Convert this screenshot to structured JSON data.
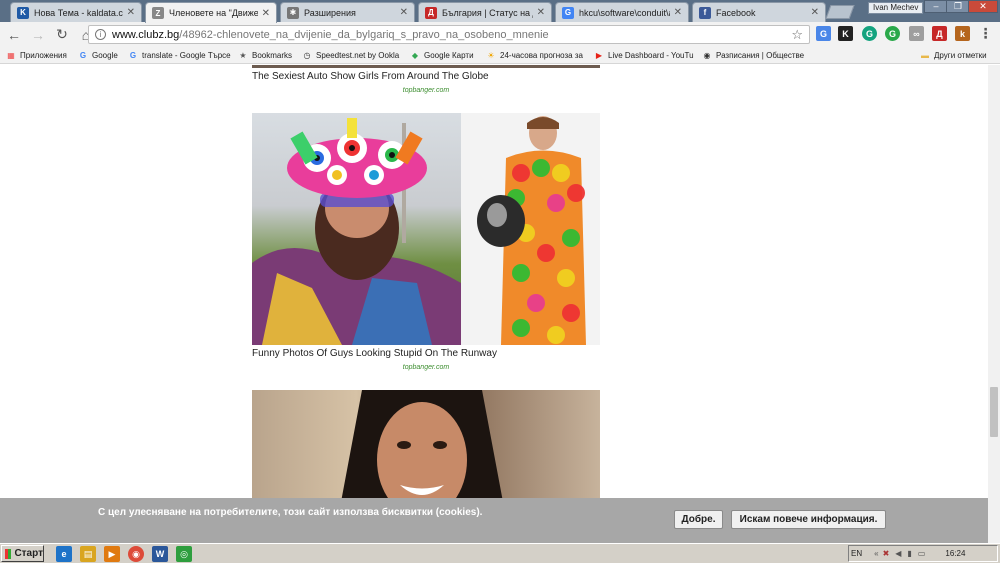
{
  "tabs": [
    {
      "title": "Нова Тема - kaldata.com",
      "favicon": "kaldata-icon",
      "fav_letter": "K",
      "fav_color": "#1f5aa6"
    },
    {
      "title": "Членовете на \"Движение",
      "favicon": "clubz-icon",
      "fav_letter": "Z",
      "fav_color": "#888888"
    },
    {
      "title": "Разширения",
      "favicon": "puzzle-icon",
      "fav_letter": "✱",
      "fav_color": "#777777"
    },
    {
      "title": "България | Статус на де",
      "favicon": "dnevnik-icon",
      "fav_letter": "Д",
      "fav_color": "#c62828"
    },
    {
      "title": "hkcu\\software\\conduit\\ap",
      "favicon": "google-icon",
      "fav_letter": "G",
      "fav_color": "#4285f4"
    },
    {
      "title": "Facebook",
      "favicon": "facebook-icon",
      "fav_letter": "f",
      "fav_color": "#3b5998"
    }
  ],
  "tab_close": "✕",
  "profile_name": "Ivan Mechev",
  "window_controls": {
    "minimize": "–",
    "maximize": "❐",
    "close": "✕"
  },
  "toolbar": {
    "url_domain": "www.clubz.bg",
    "url_path": "/48962-chlenovete_na_dvijenie_da_bylgariq_s_pravo_na_osobeno_mnenie",
    "back": "←",
    "forward": "→",
    "reload": "↻",
    "home": "⌂",
    "star": "☆",
    "menu": "⋮"
  },
  "extensions": [
    {
      "icon": "translate-ext-icon",
      "label": "G",
      "color": "#4a86e8"
    },
    {
      "icon": "k-ext-icon",
      "label": "K",
      "color": "#222222"
    },
    {
      "icon": "grammarly-ext-icon",
      "label": "G",
      "color": "#14a37f"
    },
    {
      "icon": "g-ext-icon",
      "label": "G",
      "color": "#2aa84a"
    },
    {
      "icon": "link-ext-icon",
      "label": "∞",
      "color": "#9e9e9e"
    },
    {
      "icon": "d-ext-icon",
      "label": "Д",
      "color": "#c62828"
    },
    {
      "icon": "kaldata-ext-icon",
      "label": "k",
      "color": "#b5651d"
    }
  ],
  "bookmarks": [
    {
      "label": "Приложения",
      "icon": "apps-icon",
      "glyph": "▦",
      "color": "#e44"
    },
    {
      "label": "Google",
      "icon": "google-icon",
      "glyph": "G",
      "color": "#4285f4"
    },
    {
      "label": "translate - Google Търсе",
      "icon": "google-icon",
      "glyph": "G",
      "color": "#4285f4"
    },
    {
      "label": "Bookmarks",
      "icon": "star-icon",
      "glyph": "★",
      "color": "#555"
    },
    {
      "label": "Speedtest.net by Ookla",
      "icon": "speedtest-icon",
      "glyph": "◷",
      "color": "#333"
    },
    {
      "label": "Google Карти",
      "icon": "maps-icon",
      "glyph": "◆",
      "color": "#34a853"
    },
    {
      "label": "24-часова прогноза за",
      "icon": "weather-icon",
      "glyph": "☀",
      "color": "#f0a500"
    },
    {
      "label": "Live Dashboard - YouTu",
      "icon": "youtube-icon",
      "glyph": "▶",
      "color": "#e62117"
    },
    {
      "label": "Разписания | Обществе",
      "icon": "transport-icon",
      "glyph": "◉",
      "color": "#333"
    },
    {
      "label": "Други отметки",
      "icon": "folder-icon",
      "glyph": "▬",
      "color": "#e8b84a"
    }
  ],
  "articles": [
    {
      "title": "The Sexiest Auto Show Girls From Around The Globe",
      "source": "topbanger.com"
    },
    {
      "title": "Funny Photos Of Guys Looking Stupid On The Runway",
      "source": "topbanger.com"
    }
  ],
  "cookie": {
    "text": "С цел улесняване на потребителите, този сайт използва бисквитки (cookies).",
    "ok_label": "Добре.",
    "more_label": "Искам повече информация."
  },
  "taskbar": {
    "start_label": "Старт",
    "apps": [
      {
        "icon": "ie-icon",
        "glyph": "e",
        "color": "#1e73c8"
      },
      {
        "icon": "explorer-icon",
        "glyph": "▤",
        "color": "#d9a520"
      },
      {
        "icon": "media-icon",
        "glyph": "▶",
        "color": "#e07a10"
      },
      {
        "icon": "chrome-icon",
        "glyph": "◉",
        "color": "#dd4b39"
      },
      {
        "icon": "word-icon",
        "glyph": "W",
        "color": "#2b579a"
      },
      {
        "icon": "green-app-icon",
        "glyph": "◎",
        "color": "#2e9e3e"
      }
    ],
    "lang": "EN",
    "time": "16:24"
  }
}
